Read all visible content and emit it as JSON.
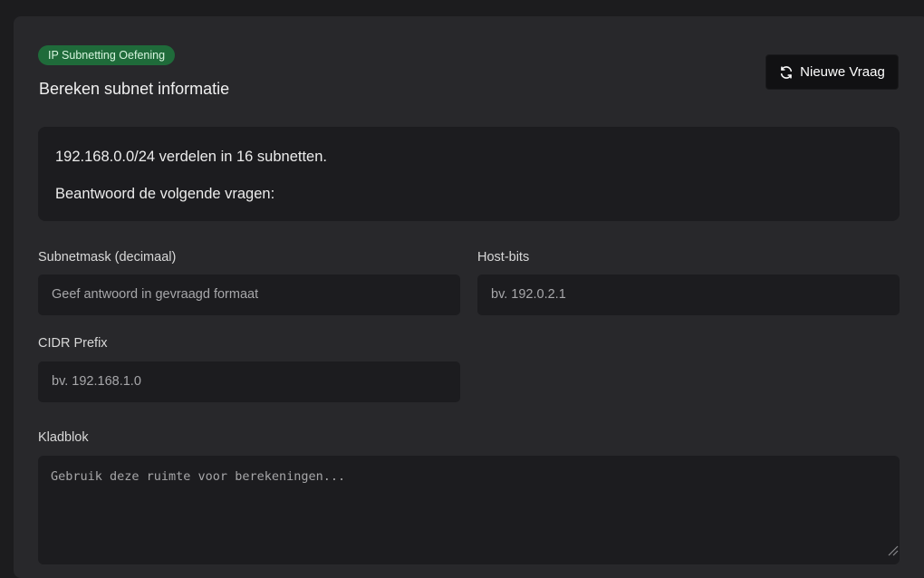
{
  "header": {
    "badge": "IP Subnetting Oefening",
    "title": "Bereken subnet informatie",
    "new_button": {
      "label": "Nieuwe Vraag",
      "icon": "refresh-icon"
    }
  },
  "question": {
    "line1": "192.168.0.0/24 verdelen in 16 subnetten.",
    "line2": "Beantwoord de volgende vragen:"
  },
  "fields": [
    {
      "label": "Subnetmask (decimaal)",
      "placeholder": "Geef antwoord in gevraagd formaat"
    },
    {
      "label": "Host-bits",
      "placeholder": "bv. 192.0.2.1"
    },
    {
      "label": "CIDR Prefix",
      "placeholder": "bv. 192.168.1.0"
    }
  ],
  "scratchpad": {
    "label": "Kladblok",
    "placeholder": "Gebruik deze ruimte voor berekeningen..."
  },
  "colors": {
    "page_bg": "#1c1c1e",
    "card_bg": "#28282b",
    "badge_bg": "#1f6b3a",
    "input_bg": "#1c1c1f",
    "button_bg": "#111113"
  }
}
